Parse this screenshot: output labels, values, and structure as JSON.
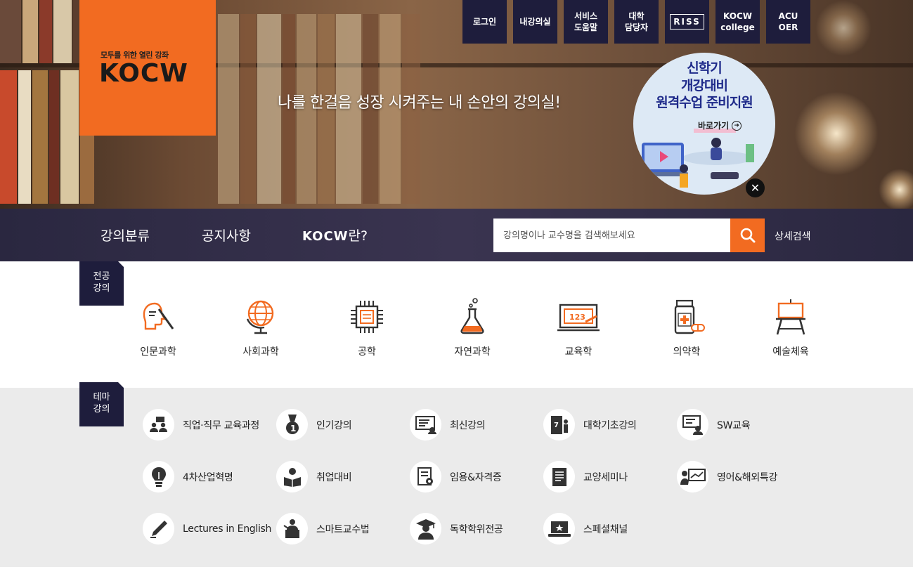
{
  "logo": {
    "tagline": "모두를 위한 열린 강좌",
    "text": "KOCW"
  },
  "top_menu": [
    {
      "label": "로그인"
    },
    {
      "label": "내강의실"
    },
    {
      "label": "서비스\n도움말"
    },
    {
      "label": "대학\n담당자"
    },
    {
      "label": "RISS"
    },
    {
      "label": "KOCW\ncollege"
    },
    {
      "label": "ACU\nOER"
    }
  ],
  "hero": {
    "slogan": "나를 한걸음 성장 시켜주는 내 손안의 강의실!"
  },
  "promo": {
    "title": "신학기\n개강대비\n원격수업 준비지원",
    "link_label": "바로가기",
    "close_icon": "close-icon"
  },
  "nav": {
    "items": [
      "강의분류",
      "공지사항"
    ],
    "kocw_logo": "KOCW",
    "kocw_suffix": "란?",
    "search_placeholder": "강의명이나 교수명을 검색해보세요",
    "advanced_search": "상세검색"
  },
  "major": {
    "label": "전공\n강의",
    "categories": [
      {
        "label": "인문과학",
        "icon": "head-icon"
      },
      {
        "label": "사회과학",
        "icon": "globe-icon"
      },
      {
        "label": "공학",
        "icon": "chip-icon"
      },
      {
        "label": "자연과학",
        "icon": "flask-icon"
      },
      {
        "label": "교육학",
        "icon": "blackboard-icon"
      },
      {
        "label": "의약학",
        "icon": "medicine-icon"
      },
      {
        "label": "예술체육",
        "icon": "easel-icon"
      }
    ]
  },
  "theme": {
    "label": "테마\n강의",
    "items": [
      {
        "label": "직업·직무 교육과정",
        "icon": "people-icon"
      },
      {
        "label": "인기강의",
        "icon": "medal-icon"
      },
      {
        "label": "최신강의",
        "icon": "new-board-icon"
      },
      {
        "label": "대학기초강의",
        "icon": "door-icon"
      },
      {
        "label": "SW교육",
        "icon": "monitor-user-icon"
      },
      {
        "label": "4차산업혁명",
        "icon": "lightbulb-icon"
      },
      {
        "label": "취업대비",
        "icon": "reader-icon"
      },
      {
        "label": "임용&자격증",
        "icon": "certificate-icon"
      },
      {
        "label": "교양세미나",
        "icon": "book-icon"
      },
      {
        "label": "영어&해외특강",
        "icon": "presentation-icon"
      },
      {
        "label": "Lectures in English",
        "icon": "pen-icon"
      },
      {
        "label": "스마트교수법",
        "icon": "lecturer-icon"
      },
      {
        "label": "독학학위전공",
        "icon": "graduate-icon"
      },
      {
        "label": "스페셜채널",
        "icon": "laptop-star-icon"
      }
    ]
  },
  "colors": {
    "accent": "#f26b21",
    "navy": "#1e1d3c",
    "theme_bg": "#ebebeb"
  }
}
